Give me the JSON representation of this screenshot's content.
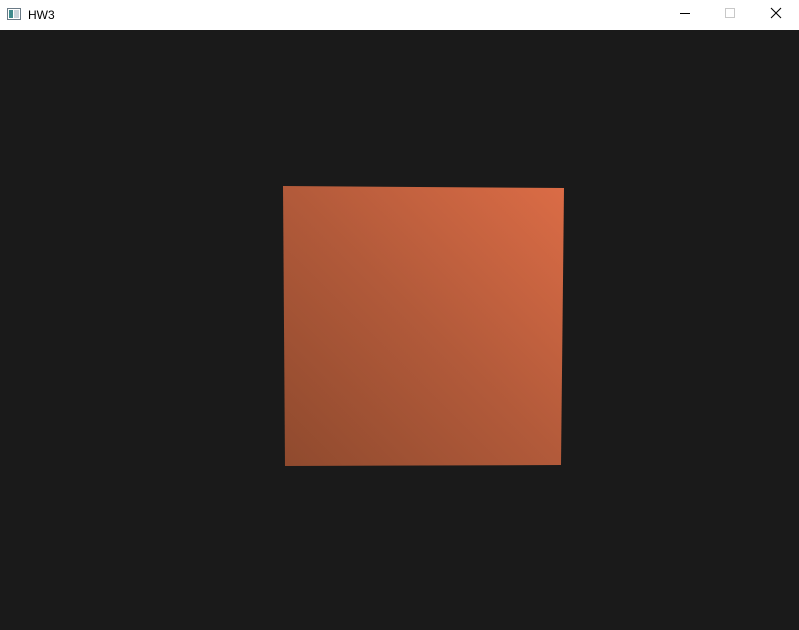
{
  "window": {
    "title": "HW3",
    "icon": "app-window-icon",
    "controls": {
      "minimize_icon": "minimize-icon",
      "maximize_icon": "maximize-icon",
      "close_icon": "close-icon"
    }
  },
  "scene": {
    "background_color": "#1a1a1a",
    "object": "shaded-square-face",
    "face_color_light": "#d96c46",
    "face_color_dark": "#8f4a2e"
  }
}
